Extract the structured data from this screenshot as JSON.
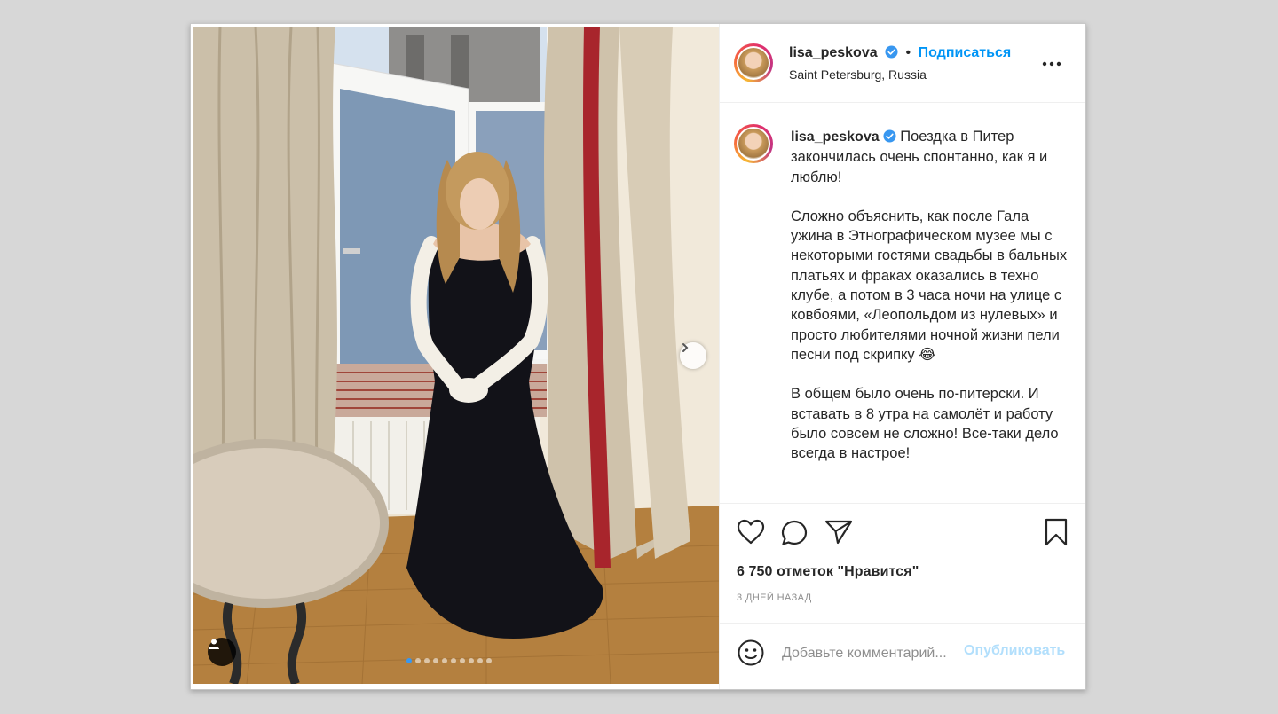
{
  "post": {
    "username": "lisa_peskova",
    "separator": "•",
    "follow_label": "Подписаться",
    "location": "Saint Petersburg, Russia",
    "more_icon": "more-horizontal-icon",
    "carousel": {
      "current_slide": 1,
      "total_slides": 10
    },
    "caption_paragraphs": [
      "Поездка в Питер закончилась очень спонтанно, как я и люблю!",
      "Сложно объяснить, как после Гала ужина в Этнографическом музее мы с некоторыми гостями свадьбы в бальных платьях и фраках оказались в техно клубе, а потом в 3 часа ночи на улице с ковбоями, «Леопольдом из нулевых» и просто любителями ночной жизни пели песни под скрипку 😂",
      "В общем было очень по-питерски. И вставать в 8 утра на самолёт и работу было совсем не сложно! Все-таки дело всегда в настрое!"
    ],
    "likes_text": "6 750 отметок \"Нравится\"",
    "date_text": "3 дней назад",
    "comment": {
      "placeholder": "Добавьте комментарий...",
      "publish_label": "Опубликовать"
    }
  },
  "colors": {
    "accent": "#0095f6",
    "verified": "#3897f0",
    "publish_disabled": "#b2dffc",
    "page_background": "#d7d7d7"
  }
}
